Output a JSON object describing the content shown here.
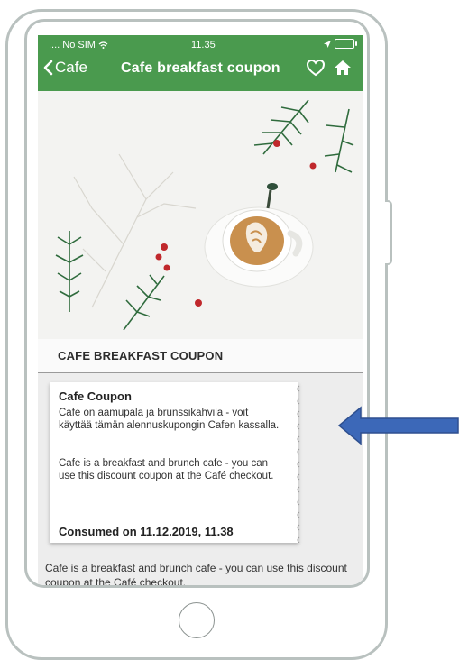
{
  "status_bar": {
    "carrier": "No SIM",
    "time": "11.35"
  },
  "nav": {
    "back_label": "Cafe",
    "title": "Cafe breakfast coupon"
  },
  "section": {
    "title": "CAFE BREAKFAST COUPON"
  },
  "coupon": {
    "title": "Cafe Coupon",
    "text_fi": "Cafe on aamupala ja brunssikahvila - voit käyttää tämän alennuskupongin Cafen kassalla.",
    "text_en": "Cafe is a breakfast and brunch cafe - you can use this discount coupon at the Café checkout.",
    "consumed": "Consumed on 11.12.2019, 11.38"
  },
  "description": "Cafe is a breakfast and brunch cafe - you can use this discount coupon at the Café checkout.",
  "colors": {
    "nav_green": "#4a9a4e",
    "arrow_blue": "#3c68b8"
  }
}
